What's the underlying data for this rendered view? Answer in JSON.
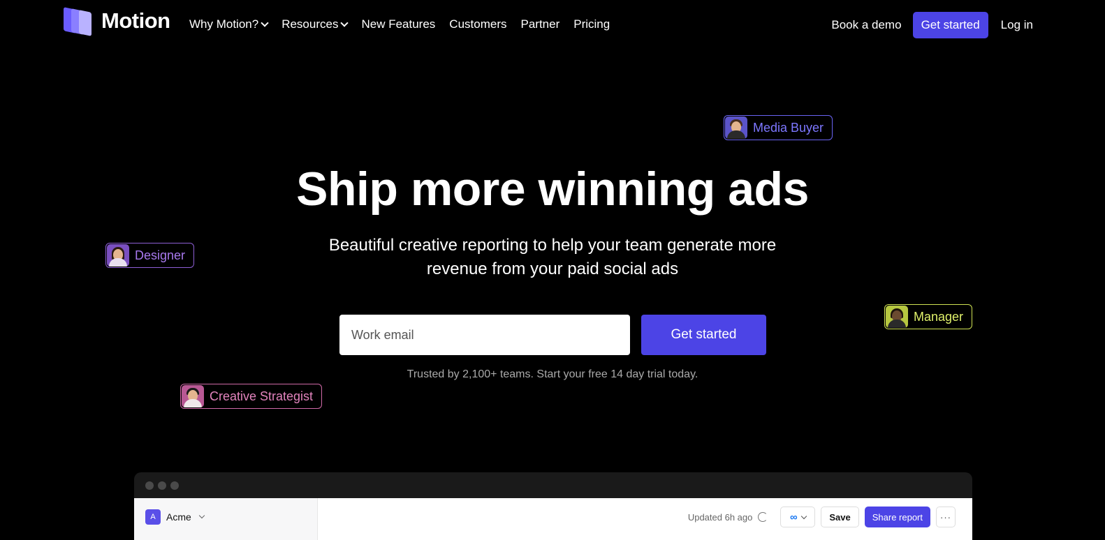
{
  "brand": {
    "name": "Motion"
  },
  "nav": {
    "links": [
      {
        "label": "Why Motion?",
        "dropdown": true
      },
      {
        "label": "Resources",
        "dropdown": true
      },
      {
        "label": "New Features",
        "dropdown": false
      },
      {
        "label": "Customers",
        "dropdown": false
      },
      {
        "label": "Partner",
        "dropdown": false
      },
      {
        "label": "Pricing",
        "dropdown": false
      }
    ],
    "book_demo": "Book a demo",
    "get_started": "Get started",
    "login": "Log in"
  },
  "hero": {
    "title": "Ship more winning ads",
    "subtitle_line1": "Beautiful creative reporting to help your team generate more",
    "subtitle_line2": "revenue from your paid social ads",
    "email_placeholder": "Work email",
    "cta": "Get started",
    "trust": "Trusted by 2,100+ teams. Start your free 14 day trial today."
  },
  "roles": {
    "media_buyer": "Media Buyer",
    "designer": "Designer",
    "manager": "Manager",
    "creative_strategist": "Creative Strategist"
  },
  "app_preview": {
    "workspace_initial": "A",
    "workspace_name": "Acme",
    "updated": "Updated 6h ago",
    "platform_icon": "meta-icon",
    "save": "Save",
    "share": "Share report",
    "more": "···"
  },
  "colors": {
    "accent": "#4c44e6",
    "background": "#000000"
  }
}
